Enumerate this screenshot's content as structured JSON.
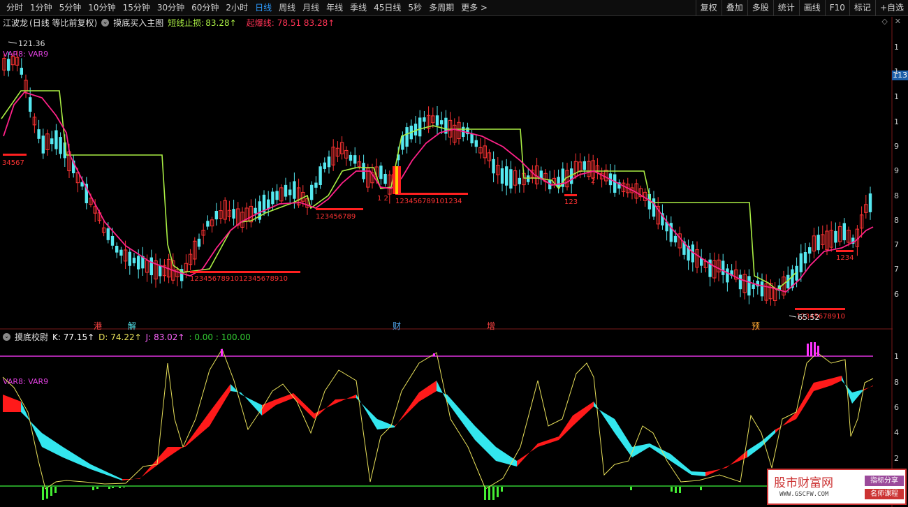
{
  "toolbar": {
    "periods": [
      "分时",
      "1分钟",
      "5分钟",
      "10分钟",
      "15分钟",
      "30分钟",
      "60分钟",
      "2小时",
      "日线",
      "周线",
      "月线",
      "年线",
      "季线",
      "45日线",
      "5秒",
      "多周期",
      "更多 >"
    ],
    "active_period": "日线",
    "right_items": [
      "复权",
      "叠加",
      "多股",
      "统计",
      "画线",
      "F10",
      "标记",
      "+自选"
    ]
  },
  "main_panel": {
    "stock_name": "江波龙",
    "mode": "(日线 等比前复权)",
    "indicator_name": "摸底买入主图",
    "short_stop_label": "短线止损:",
    "short_stop_value": "83.28↑",
    "start_label": "起爆线:",
    "start_values": "78.51  83.28↑",
    "var_label": "VAR8: VAR9",
    "high_marker": "121.36",
    "low_marker": "65.52",
    "current_price_tag": "113",
    "y_axis_labels": [
      "1",
      "1",
      "1",
      "1",
      "9",
      "9",
      "8",
      "8",
      "7",
      "7",
      "6"
    ],
    "annotations": [
      "港",
      "解",
      "财",
      "增",
      "预"
    ],
    "counters": [
      "34567",
      "1234567891012345678910",
      "123456789",
      "1 2",
      "123456789101234",
      "2",
      "123",
      "12345678910",
      "1234"
    ]
  },
  "sub_panel": {
    "indicator_name": "摸底校尉",
    "k_label": "K: 77.15↑",
    "d_label": "D: 74.22↑",
    "j_label": "J: 83.02↑",
    "extra_label": ": 0.00  : 100.00",
    "var_label": "VAR8: VAR9",
    "y_axis_labels": [
      "1",
      "8",
      "6",
      "4",
      "2"
    ]
  },
  "watermark": {
    "main": "股市财富网",
    "url": "WWW.GSCFW.COM",
    "tag1": "指标分享",
    "tag2": "名师课程"
  },
  "colors": {
    "up": "#ff3333",
    "down": "#55e8f0",
    "support": "#aaee44",
    "ma": "#ff2288",
    "kdj_fill_up": "#ff1a1a",
    "kdj_fill_down": "#33e6ee",
    "yellow": "#e8e05a",
    "magenta": "#dd33dd",
    "green": "#33cc33"
  }
}
